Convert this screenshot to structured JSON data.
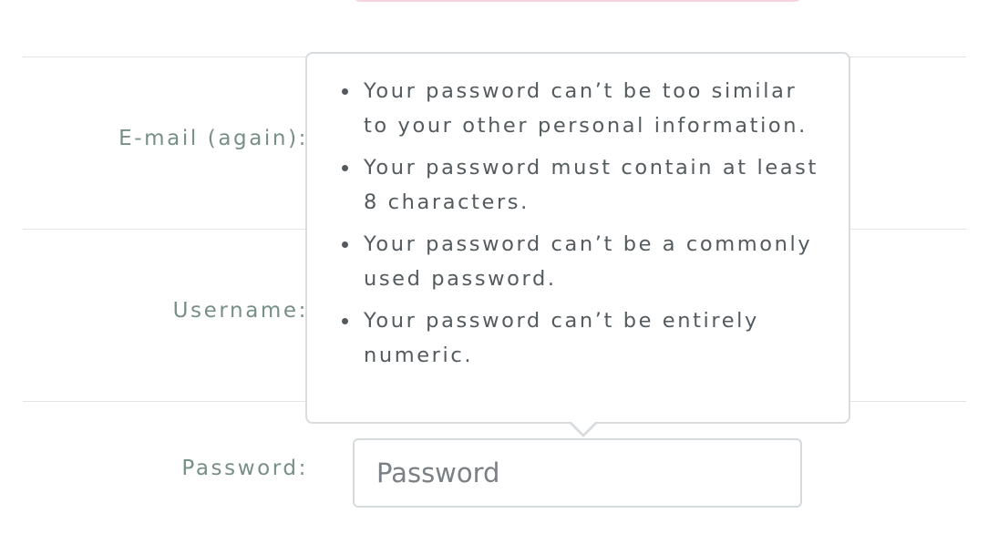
{
  "form": {
    "email_again_label": "E-mail (again):",
    "username_label": "Username:",
    "password_label": "Password:",
    "password_placeholder": "Password"
  },
  "password_help": {
    "rules": [
      "Your password can’t be too similar to your other personal information.",
      "Your password must contain at least 8 characters.",
      "Your password can’t be a commonly used password.",
      "Your password can’t be entirely numeric."
    ]
  },
  "colors": {
    "label_text": "#778f86",
    "tooltip_text": "#545b5f",
    "divider": "#e4e4e4",
    "input_border": "#d5dadc",
    "top_field_border": "#f4d4de"
  }
}
